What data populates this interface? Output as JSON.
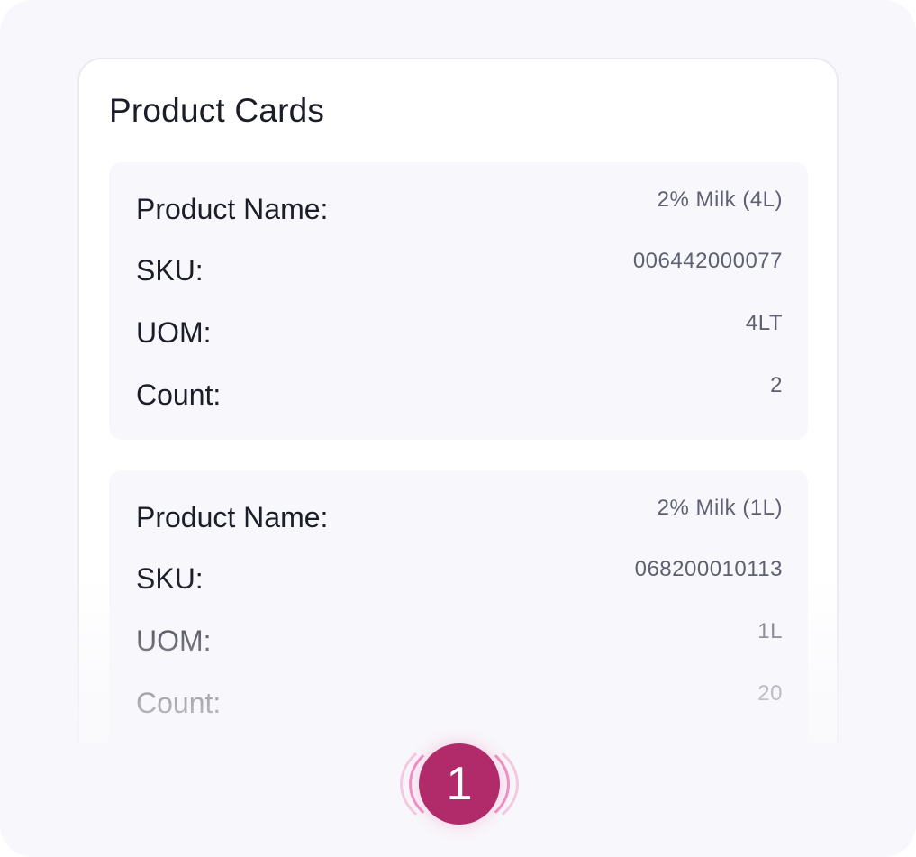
{
  "panel": {
    "title": "Product Cards"
  },
  "labels": {
    "product_name": "Product Name:",
    "sku": "SKU:",
    "uom": "UOM:",
    "count": "Count:"
  },
  "cards": [
    {
      "product_name": "2% Milk (4L)",
      "sku": "006442000077",
      "uom": "4LT",
      "count": "2"
    },
    {
      "product_name": "2% Milk (1L)",
      "sku": "068200010113",
      "uom": "1L",
      "count": "20"
    }
  ],
  "step_badge": {
    "number": "1"
  },
  "colors": {
    "accent": "#b12a6a",
    "glow": "#ec4096",
    "card_bg": "#f8f7fc"
  }
}
